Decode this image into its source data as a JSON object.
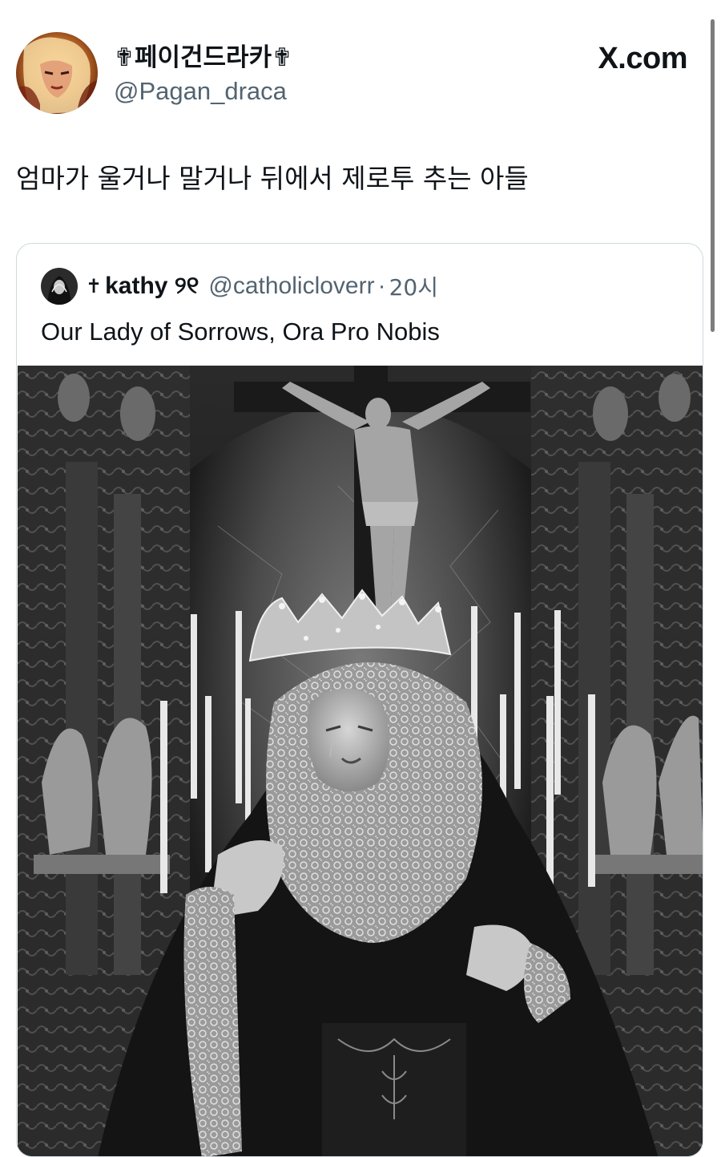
{
  "post": {
    "author_display_name": "✟페이건드라카✟",
    "author_handle": "@Pagan_draca",
    "brand": "X.com",
    "text": "엄마가 울거나 말거나 뒤에서 제로투 추는 아들"
  },
  "quoted_post": {
    "cross_symbol": "✝",
    "display_name": "kathy ୨୧",
    "handle": "@catholicloverr",
    "separator": "·",
    "time": "20시",
    "text": "Our Lady of Sorrows, Ora Pro Nobis"
  },
  "icons": {
    "author_avatar": "avatar-photo",
    "quoted_avatar": "avatar-photo",
    "media": "photo"
  }
}
